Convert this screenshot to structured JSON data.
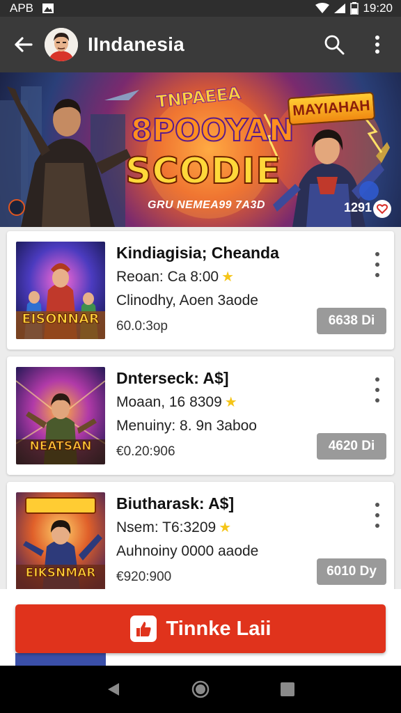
{
  "status_bar": {
    "carrier": "APB",
    "time": "19:20"
  },
  "app_bar": {
    "title": "IIndanesia"
  },
  "banner": {
    "headline_top": "TNPAEEA",
    "headline_mid": "8POOYAN",
    "headline_big": "SCODIE",
    "side_tag": "MAYIAHAH",
    "caption": "GRU NEMEA99 7A3D",
    "count": "1291"
  },
  "games": [
    {
      "name": "Kindiagisia; Cheanda",
      "line1": "Reoan: Ca 8:00",
      "line2": "Clinodhy, Aoen 3aode",
      "line3": "60.0:3op",
      "price": "6638 Di",
      "thumb_title": "EISONNAR"
    },
    {
      "name": "Dnterseck: A$]",
      "line1": "Moaan, 16 8309",
      "line2": "Menuiny: 8. 9n 3aboo",
      "line3": "€0.20:906",
      "price": "4620 Di",
      "thumb_title": "NEATSAN"
    },
    {
      "name": "Biutharask: A$]",
      "line1": "Nsem: T6:3209",
      "line2": "Auhnoiny 0000 aaode",
      "line3": "€920:900",
      "price": "6010 Dy",
      "thumb_title": "EIKSNMAR"
    }
  ],
  "cta": {
    "label": "Tinnke Laii"
  },
  "colors": {
    "app_bar": "#3a3a3a",
    "cta": "#e0331c",
    "price_chip": "#9a9a9a",
    "star": "#f5c518"
  }
}
